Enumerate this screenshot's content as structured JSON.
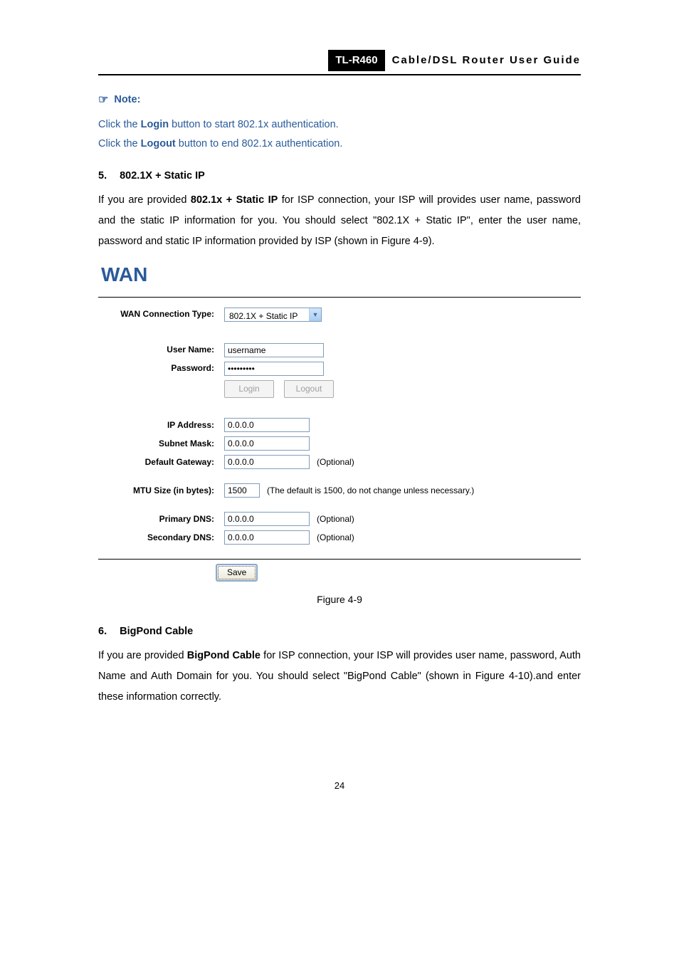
{
  "header": {
    "model": "TL-R460",
    "title": "Cable/DSL  Router  User  Guide"
  },
  "note": {
    "label": "Note:",
    "line1_pre": "Click the ",
    "line1_bold": "Login",
    "line1_post": " button to start 802.1x authentication.",
    "line2_pre": "Click the ",
    "line2_bold": "Logout",
    "line2_post": " button to end 802.1x authentication."
  },
  "section5": {
    "number": "5.",
    "title": "802.1X + Static IP",
    "body_pre": "If you are provided ",
    "body_bold": "802.1x + Static IP",
    "body_post": " for ISP connection, your ISP will provides user name, password and the static IP information for you. You should select \"802.1X + Static IP\", enter the user name, password and static IP information provided by ISP (shown in Figure 4-9)."
  },
  "wan": {
    "title": "WAN",
    "labels": {
      "conn_type": "WAN Connection Type:",
      "username": "User Name:",
      "password": "Password:",
      "ip": "IP Address:",
      "subnet": "Subnet Mask:",
      "gateway": "Default Gateway:",
      "mtu": "MTU Size (in bytes):",
      "primary_dns": "Primary DNS:",
      "secondary_dns": "Secondary DNS:"
    },
    "values": {
      "conn_type": "802.1X + Static IP",
      "username": "username",
      "password": "•••••••••",
      "ip": "0.0.0.0",
      "subnet": "0.0.0.0",
      "gateway": "0.0.0.0",
      "mtu": "1500",
      "primary_dns": "0.0.0.0",
      "secondary_dns": "0.0.0.0"
    },
    "hints": {
      "optional": "(Optional)",
      "mtu": "(The default is 1500, do not change unless necessary.)"
    },
    "buttons": {
      "login": "Login",
      "logout": "Logout",
      "save": "Save"
    }
  },
  "figure_caption": "Figure 4-9",
  "section6": {
    "number": "6.",
    "title": "BigPond Cable",
    "body_pre": "If you are provided ",
    "body_bold": "BigPond Cable",
    "body_post": " for ISP connection, your ISP will provides user name, password, Auth Name and Auth Domain for you. You should select \"BigPond Cable\" (shown in Figure 4-10).and enter these information correctly."
  },
  "page_number": "24"
}
